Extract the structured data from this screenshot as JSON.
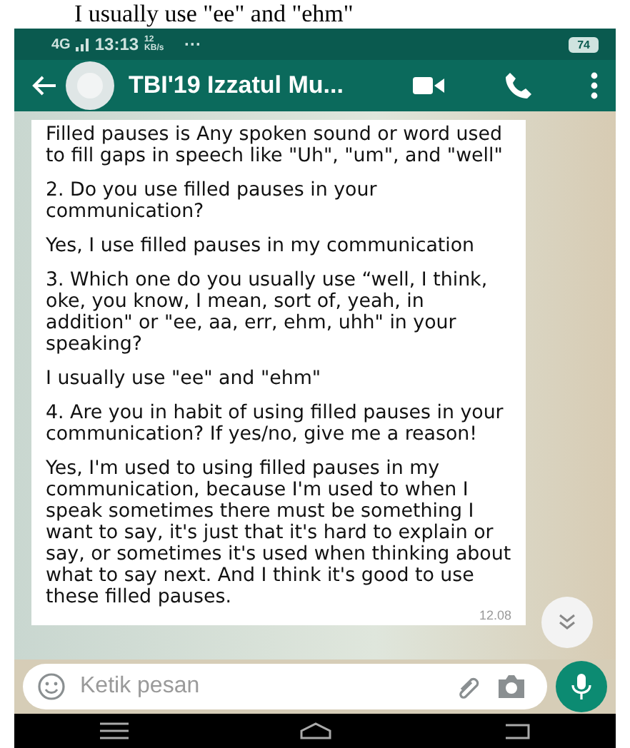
{
  "document_text": "I usually use \"ee\" and \"ehm\"",
  "status_bar": {
    "network": "4G",
    "time": "13:13",
    "speed": "12 KB/s",
    "more": "···",
    "battery": "74"
  },
  "header": {
    "title": "TBI'19 Izzatul Mu..."
  },
  "message": {
    "paragraphs": [
      "Filled pauses is Any spoken sound or word used to fill gaps in speech like \"Uh\", \"um\", and \"well\"",
      "2. Do you use filled pauses in your communication?",
      "Yes, I use filled pauses in my communication",
      "3. Which one do you usually use “well, I think, oke, you know, I mean, sort of, yeah, in addition\" or \"ee, aa, err, ehm, uhh\" in your speaking?",
      "I usually use \"ee\" and \"ehm\"",
      "4. Are you in habit  of using filled pauses in your communication? If yes/no, give me a reason!",
      "Yes, I'm used to using filled pauses in my communication, because I'm used to when I speak sometimes there must be something I want to say, it's just that it's hard to explain or say, or sometimes it's used when thinking about what to say next.  And I think it's good to use these filled pauses."
    ],
    "time": "12.08"
  },
  "composer": {
    "placeholder": "Ketik pesan"
  }
}
